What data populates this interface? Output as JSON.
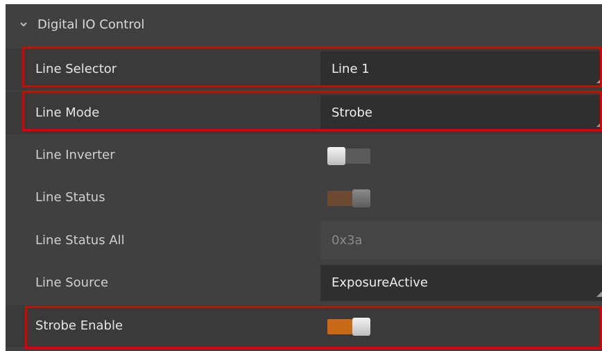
{
  "section": {
    "title": "Digital IO Control"
  },
  "rows": [
    {
      "label": "Line Selector",
      "value": "Line 1"
    },
    {
      "label": "Line Mode",
      "value": "Strobe"
    },
    {
      "label": "Line Inverter",
      "toggle": "off"
    },
    {
      "label": "Line Status",
      "toggle": "on (disabled)"
    },
    {
      "label": "Line Status All",
      "value": "0x3a"
    },
    {
      "label": "Line Source",
      "value": "ExposureActive"
    },
    {
      "label": "Strobe Enable",
      "toggle": "on"
    }
  ],
  "colors": {
    "panel_bg": "#404040",
    "field_bg": "#2f2f2f",
    "toggle_on": "#c96a19",
    "highlight_border": "#e00000"
  },
  "icons": [
    "chevron-down-icon",
    "dropdown-corner-icon"
  ]
}
